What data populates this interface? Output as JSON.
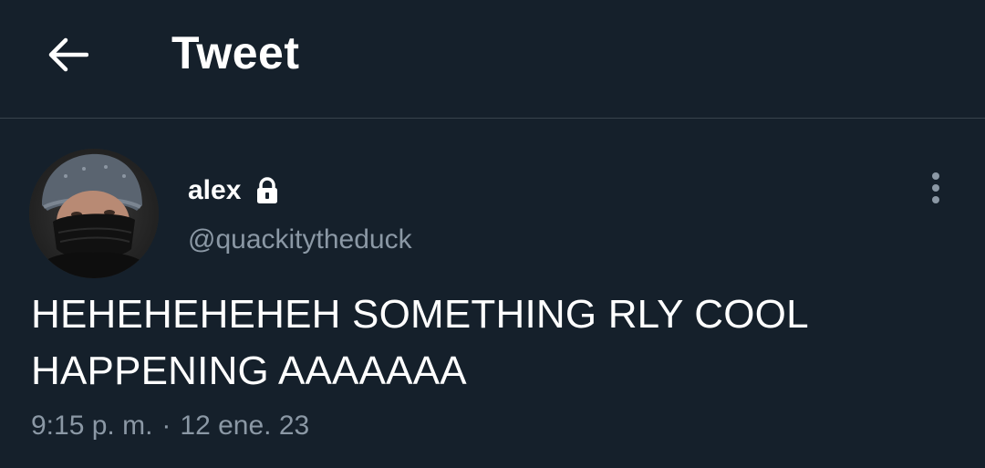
{
  "header": {
    "back_icon": "arrow-left-icon",
    "title": "Tweet"
  },
  "author": {
    "display_name": "alex",
    "protected_icon": "lock-icon",
    "handle": "@quackitytheduck",
    "avatar_desc": "avatar-photo"
  },
  "tweet": {
    "text": "HEHEHEHEHEH SOMETHING RLY COOL HAPPENING AAAAAAA",
    "time": "9:15 p. m.",
    "separator": "·",
    "date": "12 ene. 23"
  },
  "more_icon": "more-vertical-icon",
  "colors": {
    "background": "#15202b",
    "text": "#ffffff",
    "secondary_text": "#8b98a5",
    "divider": "#38444d"
  }
}
